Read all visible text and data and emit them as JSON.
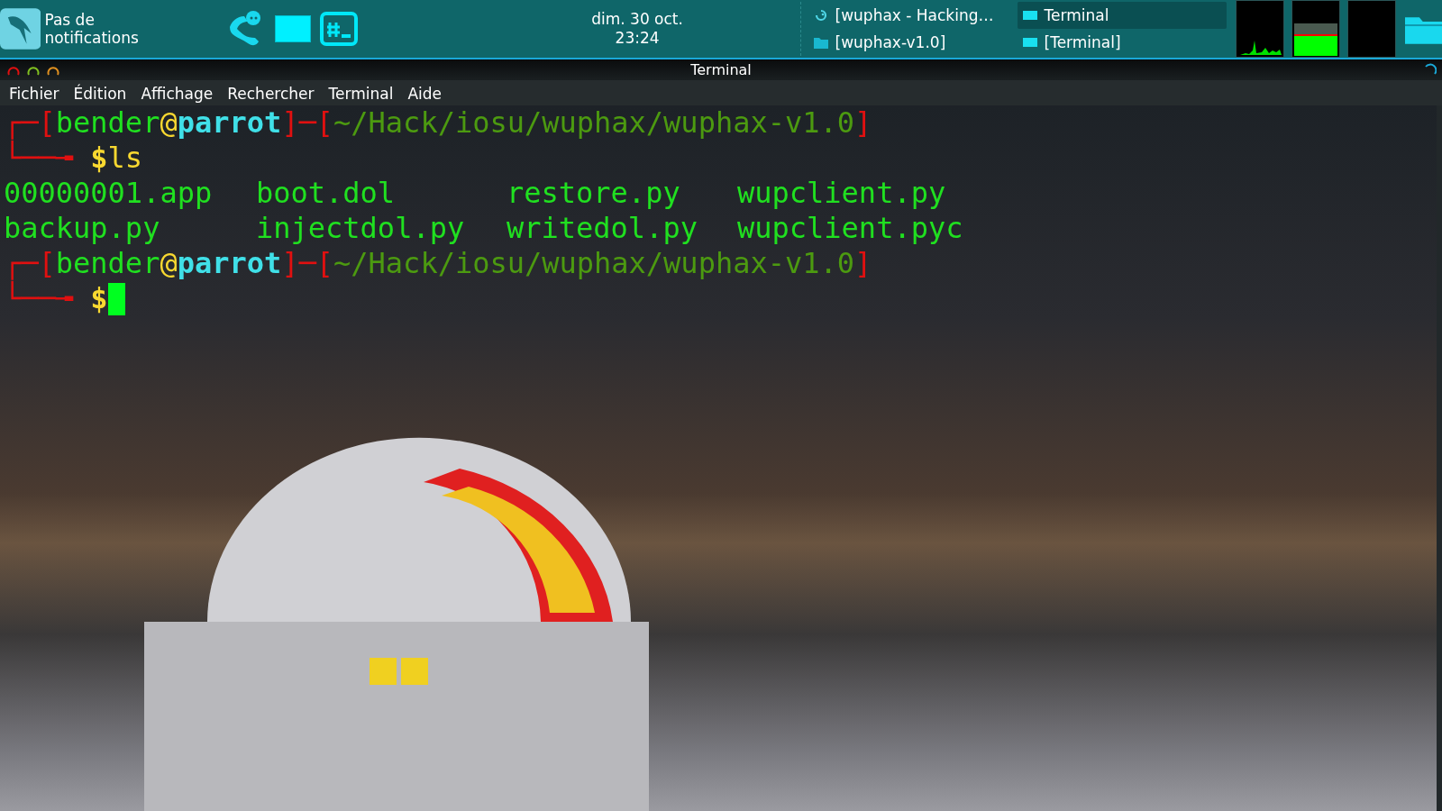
{
  "top_panel": {
    "notifications": "Pas de notifications",
    "clock": {
      "date": "dim. 30 oct.",
      "time": "23:24"
    },
    "tasks": [
      {
        "label": "[wuphax - Hacking…",
        "kind": "browser",
        "selected": false
      },
      {
        "label": "Terminal",
        "kind": "terminal",
        "selected": true
      },
      {
        "label": "[wuphax-v1.0]",
        "kind": "folder",
        "selected": false
      },
      {
        "label": "[Terminal]",
        "kind": "terminal",
        "selected": false
      }
    ]
  },
  "window": {
    "title": "Terminal",
    "menu": [
      "Fichier",
      "Édition",
      "Affichage",
      "Rechercher",
      "Terminal",
      "Aide"
    ],
    "lines": [
      {
        "kind": "prompt",
        "segments": [
          {
            "text": "┌─[",
            "kind": "frame"
          },
          {
            "text": "bender",
            "kind": "user"
          },
          {
            "text": "@",
            "kind": "at"
          },
          {
            "text": "parrot",
            "kind": "host"
          },
          {
            "text": "]─[",
            "kind": "frame"
          },
          {
            "text": "~/Hack/iosu/wuphax/wuphax-v1.0",
            "kind": "path"
          },
          {
            "text": "]",
            "kind": "frame"
          }
        ]
      },
      {
        "kind": "command",
        "corner": "└──╼ ",
        "sign": "$",
        "command": "ls",
        "cursor": false
      },
      {
        "kind": "output",
        "cells": [
          "00000001.app",
          "boot.dol",
          "restore.py",
          "wupclient.py"
        ]
      },
      {
        "kind": "output",
        "cells": [
          "backup.py",
          "injectdol.py",
          "writedol.py",
          "wupclient.pyc"
        ]
      },
      {
        "kind": "prompt",
        "segments": [
          {
            "text": "┌─[",
            "kind": "frame"
          },
          {
            "text": "bender",
            "kind": "user"
          },
          {
            "text": "@",
            "kind": "at"
          },
          {
            "text": "parrot",
            "kind": "host"
          },
          {
            "text": "]─[",
            "kind": "frame"
          },
          {
            "text": "~/Hack/iosu/wuphax/wuphax-v1.0",
            "kind": "path"
          },
          {
            "text": "]",
            "kind": "frame"
          }
        ]
      },
      {
        "kind": "command",
        "corner": "└──╼ ",
        "sign": "$",
        "cursor": true
      }
    ]
  }
}
